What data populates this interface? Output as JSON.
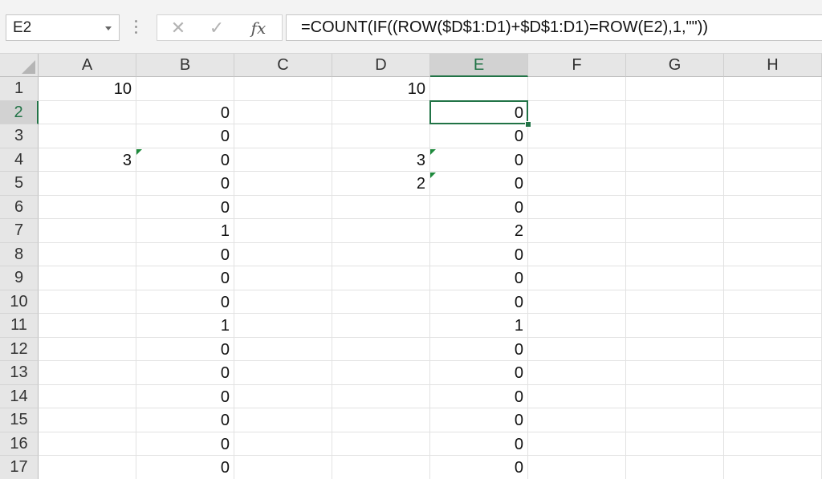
{
  "formula_bar": {
    "name_box": "E2",
    "fx_label": "fx",
    "formula": "=COUNT(IF((ROW($D$1:D1)+$D$1:D1)=ROW(E2),1,\"\"))"
  },
  "columns": [
    "A",
    "B",
    "C",
    "D",
    "E",
    "F",
    "G",
    "H"
  ],
  "rows": [
    "1",
    "2",
    "3",
    "4",
    "5",
    "6",
    "7",
    "8",
    "9",
    "10",
    "11",
    "12",
    "13",
    "14",
    "15",
    "16",
    "17"
  ],
  "selected_cell": {
    "column": "E",
    "row": "2"
  },
  "values": {
    "A": [
      "10",
      "",
      "",
      "3",
      "",
      "",
      "",
      "",
      "",
      "",
      "",
      "",
      "",
      "",
      "",
      "",
      ""
    ],
    "B": [
      "",
      "0",
      "0",
      "0",
      "0",
      "0",
      "1",
      "0",
      "0",
      "0",
      "1",
      "0",
      "0",
      "0",
      "0",
      "0",
      "0"
    ],
    "D": [
      "10",
      "",
      "",
      "3",
      "2",
      "",
      "",
      "",
      "",
      "",
      "",
      "",
      "",
      "",
      "",
      "",
      ""
    ],
    "E": [
      "",
      "0",
      "0",
      "0",
      "0",
      "0",
      "2",
      "0",
      "0",
      "0",
      "1",
      "0",
      "0",
      "0",
      "0",
      "0",
      "0"
    ]
  },
  "error_indicators": [
    {
      "column": "A",
      "row": "4"
    },
    {
      "column": "D",
      "row": "4"
    },
    {
      "column": "D",
      "row": "5"
    }
  ],
  "colors": {
    "accent": "#217346",
    "error_triangle": "#1e8a3c"
  }
}
